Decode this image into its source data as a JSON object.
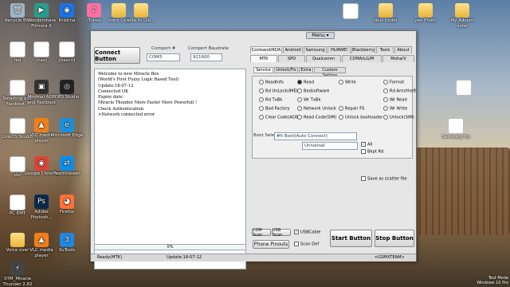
{
  "desktop": {
    "left_icons": [
      {
        "label": "Recycle Bin",
        "glyph": "🗑",
        "color": "#9fb4c7"
      },
      {
        "label": "Wondershare Filmora X",
        "glyph": "▶",
        "color": "#2a9d8f"
      },
      {
        "label": "Kristina",
        "glyph": "◉",
        "color": "#1a73e8"
      },
      {
        "label": "iTunes",
        "glyph": "♪",
        "color": "#ff6fa0"
      },
      {
        "label": "Icons Cert",
        "glyph": "",
        "color": "folder"
      },
      {
        "label": "side fo Gib...",
        "glyph": "",
        "color": "folder"
      },
      {
        "label": "ted",
        "glyph": "",
        "color": "doc"
      },
      {
        "label": "(nas)",
        "glyph": "",
        "color": "doc"
      },
      {
        "label": "(nascri)",
        "glyph": "",
        "color": "doc"
      },
      {
        "label": "Smarting eSE Fastboot...",
        "glyph": "",
        "color": "doc"
      },
      {
        "label": "Minimal ADB and Fastboot",
        "glyph": "▣",
        "color": "#333"
      },
      {
        "label": "OBS Studio",
        "glyph": "◎",
        "color": "#222"
      },
      {
        "label": "LinkOS Studio",
        "glyph": "",
        "color": "doc"
      },
      {
        "label": "VLC media player",
        "glyph": "▲",
        "color": "#f07f1a"
      },
      {
        "label": "Microsoft Edge",
        "glyph": "e",
        "color": "#1d8fd8"
      },
      {
        "label": "dvr",
        "glyph": "",
        "color": "doc"
      },
      {
        "label": "Google Chrome",
        "glyph": "◉",
        "color": "#db4437"
      },
      {
        "label": "TeamViewer",
        "glyph": "⇄",
        "color": "#0e8ee9"
      },
      {
        "label": "PC EMT",
        "glyph": "",
        "color": "doc"
      },
      {
        "label": "Adobe Photosh...",
        "glyph": "Ps",
        "color": "#0b2a4a"
      },
      {
        "label": "Firefox",
        "glyph": "◕",
        "color": "#ff7139"
      },
      {
        "label": "Voice over",
        "glyph": "",
        "color": "folder"
      },
      {
        "label": "VLC media player",
        "glyph": "▲",
        "color": "#f07f1a"
      },
      {
        "label": "3uTools",
        "glyph": "3",
        "color": "#1e88e5"
      },
      {
        "label": "XTM_Miracle Thunder 2.82",
        "glyph": "⚡",
        "color": "#444"
      }
    ],
    "right_icons": [
      {
        "label": "",
        "glyph": "",
        "color": "doc"
      },
      {
        "label": "New folder",
        "glyph": "",
        "color": "folder"
      },
      {
        "label": "yeo Photo",
        "glyph": "",
        "color": "folder"
      },
      {
        "label": "My Adoeor votei",
        "glyph": "",
        "color": "folder"
      },
      {
        "label": "",
        "glyph": "",
        "color": "doc"
      },
      {
        "label": "",
        "glyph": "",
        "color": "doc"
      },
      {
        "label": "Samsung frp",
        "glyph": "",
        "color": "doc"
      }
    ],
    "clock_text": "Windows 10 Pro",
    "build_text": "Test Mode"
  },
  "app": {
    "menu_label": "Menu ▾",
    "connect_button": "Connect Button",
    "comport_label": "Comport #",
    "comport_value": "COM3",
    "baud_label": "Comport Baudrate",
    "baud_value": "921600",
    "log_lines": [
      "Welcome to new Miracle Box",
      "(World's First Fuzzy Logic Based Tool)",
      "Update:18-07-12",
      "Connected OK",
      "Expire date:",
      "Miracle Thunder More Faster More Powerfull !",
      "Check Authentication.",
      ">Network connected error"
    ],
    "progress_text": "0%",
    "brand_tabs": [
      "Coolsand/RDA",
      "Android",
      "Samsung",
      "HUAWEI",
      "Blackberry",
      "Tools",
      "About"
    ],
    "chip_tabs": [
      "MTK",
      "SPD",
      "Qualcomm",
      "CDMA/LG/M",
      "Moha/V"
    ],
    "sub_tabs": [
      "Service",
      "Unlock/Fix",
      "Extra",
      "Custom Setting"
    ],
    "options_col1": [
      "ReadInfo",
      "Rd UnLock(IMEI)",
      "Rd TxBk",
      "Bad Factory",
      "Clear Code(ADB)"
    ],
    "options_col2": [
      "Read",
      "Badsoftware",
      "Wr TxBk",
      "Network Unlock",
      "Read Code(SIM)"
    ],
    "options_col3": [
      "Write",
      "",
      "",
      "Repair FS",
      "Unlock bootloader"
    ],
    "options_col4": [
      "Format",
      "Rd Arm/theft",
      "Wr Read",
      "Wr Write",
      "Unlock(SIM)"
    ],
    "boot_label": "Boot Select",
    "boot_value": "#h Boot(Auto Connect)",
    "universal_value": "Universal",
    "all_label": "All",
    "bkpt_label": "Bkpt Rd",
    "scatter_label": "Save as scatter file",
    "com_scan": "COM Scan",
    "usb_scan": "USB Scan",
    "usb_cable": "USBCable",
    "phone_pinouts": "Phone Pinouts",
    "scan_def": "Scan Def",
    "start_button": "Start Button",
    "stop_button": "Stop Button",
    "status_ready": "Ready(MTK)",
    "status_update": "Update:18-07-12",
    "status_team": "<GSMXTEAM>",
    "colors": {
      "accent": "#2b5fa8",
      "window_bg": "#e6e6e6"
    }
  }
}
